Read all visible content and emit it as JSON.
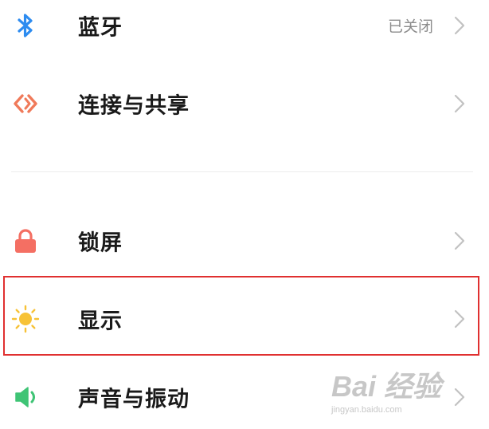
{
  "settings": {
    "items": [
      {
        "label": "蓝牙",
        "value": "已关闭",
        "icon": "bluetooth-icon",
        "icon_color": "#2e8cf0"
      },
      {
        "label": "连接与共享",
        "icon": "connection-share-icon",
        "icon_color": "#f07a5a"
      },
      {
        "label": "锁屏",
        "icon": "lock-icon",
        "icon_color": "#f46f63"
      },
      {
        "label": "显示",
        "icon": "sun-icon",
        "icon_color": "#f7c236"
      },
      {
        "label": "声音与振动",
        "icon": "speaker-icon",
        "icon_color": "#3fc475"
      }
    ]
  },
  "watermark": {
    "brand": "Bai 经验",
    "url": "jingyan.baidu.com"
  },
  "colors": {
    "highlight_border": "#e03030",
    "chevron": "#c2c2c2",
    "divider": "#ececec"
  }
}
